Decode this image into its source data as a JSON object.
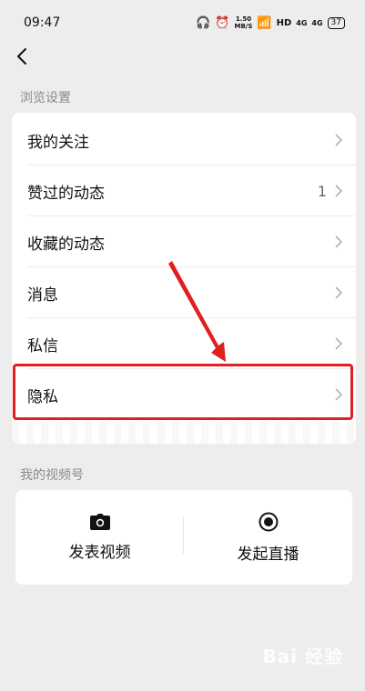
{
  "status_bar": {
    "time": "09:47",
    "speed_value": "1.50",
    "speed_unit": "MB/S",
    "hd": "HD",
    "network_1": "4G",
    "network_2": "4G",
    "battery": "37"
  },
  "nav": {
    "back_icon": "chevron-left-icon"
  },
  "browse_settings": {
    "section_title": "浏览设置",
    "items": [
      {
        "label": "我的关注",
        "count": ""
      },
      {
        "label": "赞过的动态",
        "count": "1"
      },
      {
        "label": "收藏的动态",
        "count": ""
      },
      {
        "label": "消息",
        "count": ""
      },
      {
        "label": "私信",
        "count": ""
      },
      {
        "label": "隐私",
        "count": ""
      }
    ]
  },
  "channels": {
    "section_title": "我的视频号",
    "post_video_label": "发表视频",
    "go_live_label": "发起直播"
  },
  "annotation": {
    "highlight_color": "#e02020"
  },
  "watermark": {
    "text": "Bai 经验"
  }
}
